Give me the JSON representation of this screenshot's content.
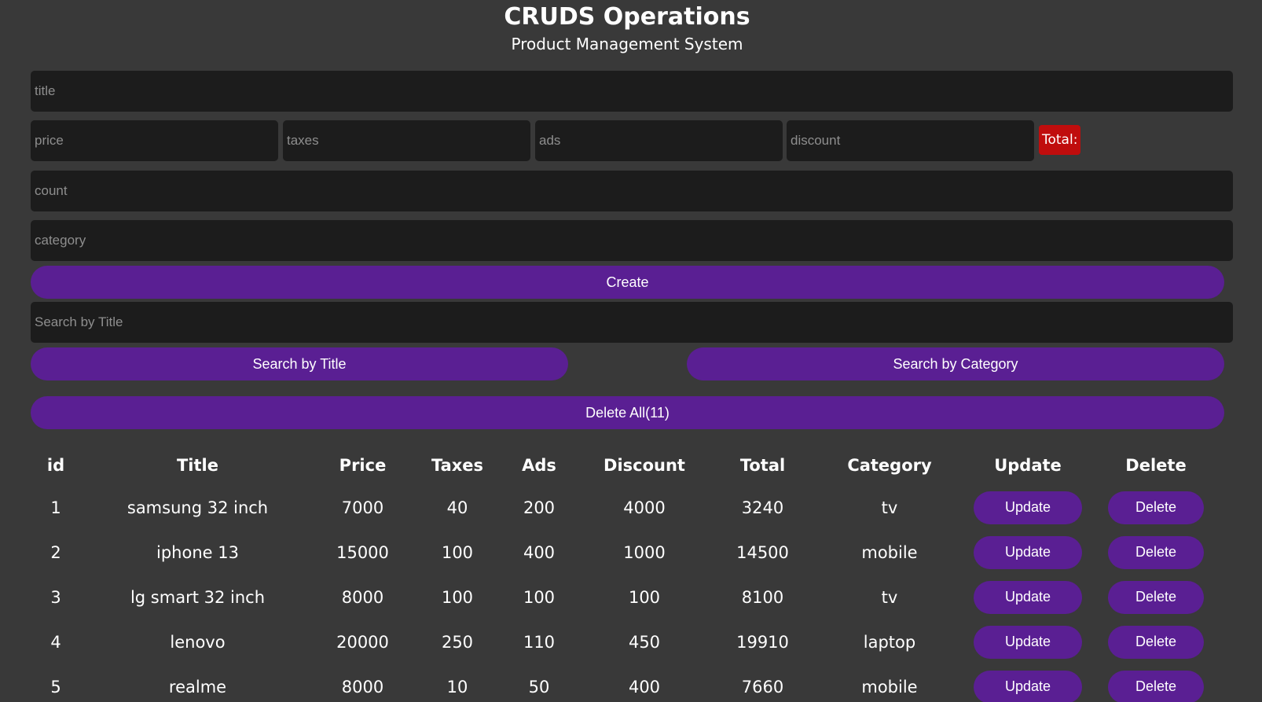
{
  "header": {
    "title": "CRUDS Operations",
    "subtitle": "Product Management System"
  },
  "form": {
    "title_placeholder": "title",
    "price_placeholder": "price",
    "taxes_placeholder": "taxes",
    "ads_placeholder": "ads",
    "discount_placeholder": "discount",
    "total_label": "Total:",
    "count_placeholder": "count",
    "category_placeholder": "category",
    "create_label": "Create"
  },
  "search": {
    "placeholder": "Search by Title",
    "by_title_label": "Search by Title",
    "by_category_label": "Search by Category"
  },
  "delete_all_label": "Delete All(11)",
  "table": {
    "headers": [
      "id",
      "Title",
      "Price",
      "Taxes",
      "Ads",
      "Discount",
      "Total",
      "Category",
      "Update",
      "Delete"
    ],
    "update_label": "Update",
    "delete_label": "Delete",
    "rows": [
      {
        "id": "1",
        "title": "samsung 32 inch",
        "price": "7000",
        "taxes": "40",
        "ads": "200",
        "discount": "4000",
        "total": "3240",
        "category": "tv"
      },
      {
        "id": "2",
        "title": "iphone 13",
        "price": "15000",
        "taxes": "100",
        "ads": "400",
        "discount": "1000",
        "total": "14500",
        "category": "mobile"
      },
      {
        "id": "3",
        "title": "lg smart 32 inch",
        "price": "8000",
        "taxes": "100",
        "ads": "100",
        "discount": "100",
        "total": "8100",
        "category": "tv"
      },
      {
        "id": "4",
        "title": "lenovo",
        "price": "20000",
        "taxes": "250",
        "ads": "110",
        "discount": "450",
        "total": "19910",
        "category": "laptop"
      },
      {
        "id": "5",
        "title": "realme",
        "price": "8000",
        "taxes": "10",
        "ads": "50",
        "discount": "400",
        "total": "7660",
        "category": "mobile"
      }
    ]
  },
  "colors": {
    "background": "#393939",
    "input_background": "#1c1c1c",
    "button": "#5a1f93",
    "total_badge": "#c00d0d"
  }
}
